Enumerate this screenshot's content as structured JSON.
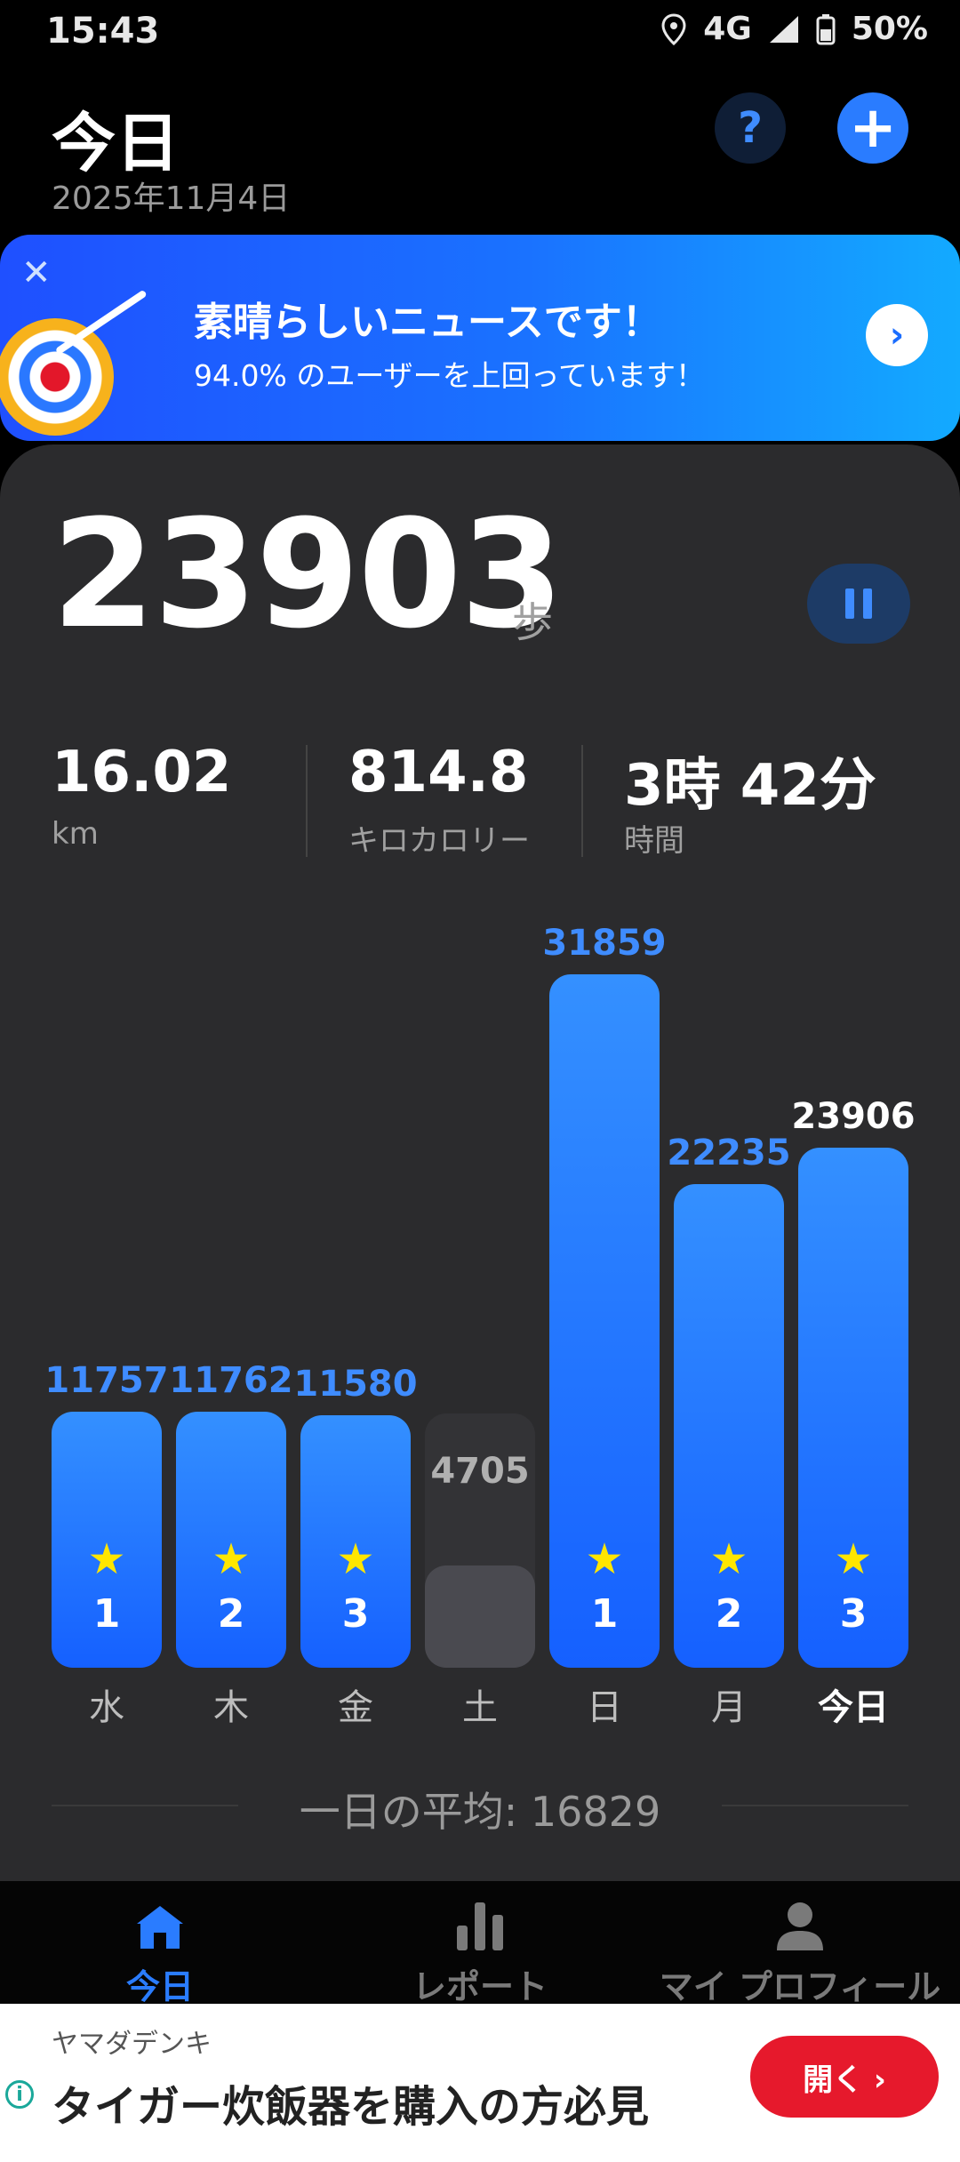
{
  "status_bar": {
    "time": "15:43",
    "network": "4G",
    "battery": "50%"
  },
  "header": {
    "title": "今日",
    "date": "2025年11月4日",
    "help_label": "?",
    "add_label": "+"
  },
  "banner": {
    "title": "素晴らしいニュースです！",
    "subtitle": "94.0% のユーザーを上回っています！",
    "close_label": "✕",
    "go_label": "›"
  },
  "summary": {
    "steps": "23903",
    "steps_unit": "歩",
    "distance_value": "16.02",
    "distance_label": "km",
    "calories_value": "814.8",
    "calories_label": "キロカロリー",
    "time_value": "3時 42分",
    "time_label": "時間"
  },
  "chart_data": {
    "type": "bar",
    "categories": [
      "水",
      "木",
      "金",
      "土",
      "日",
      "月",
      "今日"
    ],
    "values": [
      11757,
      11762,
      11580,
      4705,
      31859,
      22235,
      23906
    ],
    "goal_reached": [
      true,
      true,
      true,
      false,
      true,
      true,
      true
    ],
    "star_ranks": [
      "1",
      "2",
      "3",
      "",
      "1",
      "2",
      "3"
    ],
    "value_labels": [
      "11757",
      "11762",
      "11580",
      "4705",
      "31859",
      "22235",
      "23906"
    ]
  },
  "average": {
    "label": "一日の平均: 16829"
  },
  "nav": {
    "today": "今日",
    "report": "レポート",
    "profile": "マイ プロフィール"
  },
  "ad": {
    "sponsor": "ヤマダデンキ",
    "headline": "タイガー炊飯器を購入の方必見",
    "button": "開く ›"
  },
  "colors": {
    "accent": "#2a7cff",
    "star": "#ffe600",
    "ad_button": "#e6192c"
  }
}
